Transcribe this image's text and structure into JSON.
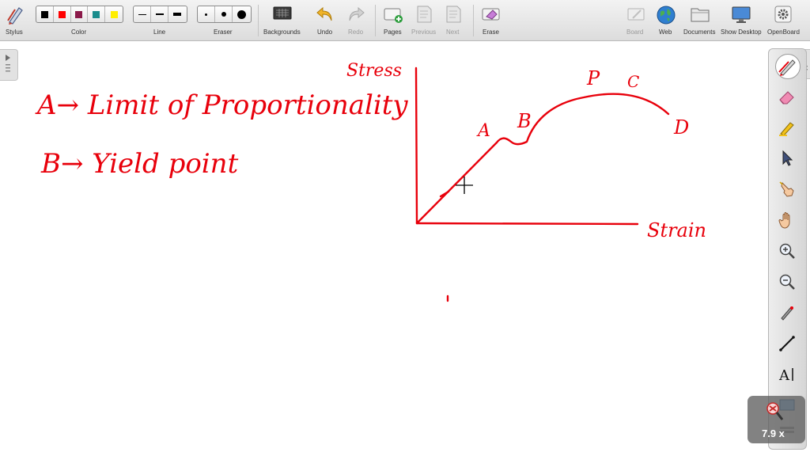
{
  "toolbar": {
    "stylus": "Stylus",
    "color": "Color",
    "line": "Line",
    "eraser": "Eraser",
    "backgrounds": "Backgrounds",
    "undo": "Undo",
    "redo": "Redo",
    "pages": "Pages",
    "previous": "Previous",
    "next": "Next",
    "erase": "Erase",
    "board": "Board",
    "web": "Web",
    "documents": "Documents",
    "show_desktop": "Show Desktop",
    "openboard": "OpenBoard",
    "colors": [
      "#000000",
      "#ff0000",
      "#8b1a4a",
      "#1a8c8c",
      "#ffee00"
    ],
    "ink_color": "#e8000b"
  },
  "palette_tools": [
    "pen-icon",
    "highlighter-eraser-icon",
    "marker-icon",
    "pointer-icon",
    "laser-hand-icon",
    "hand-icon",
    "zoom-in-icon",
    "zoom-out-icon",
    "pipette-icon",
    "line-icon",
    "text-icon",
    "capture-icon",
    "more-icon"
  ],
  "zoom": {
    "value": "7.9 x"
  },
  "board": {
    "note_a": "A→ Limit of Proportionality",
    "note_b": "B→ Yield point",
    "y_axis_label": "Stress",
    "x_axis_label": "Strain",
    "point_a": "A",
    "point_b": "B",
    "point_p": "P",
    "point_c": "C",
    "point_d": "D"
  }
}
